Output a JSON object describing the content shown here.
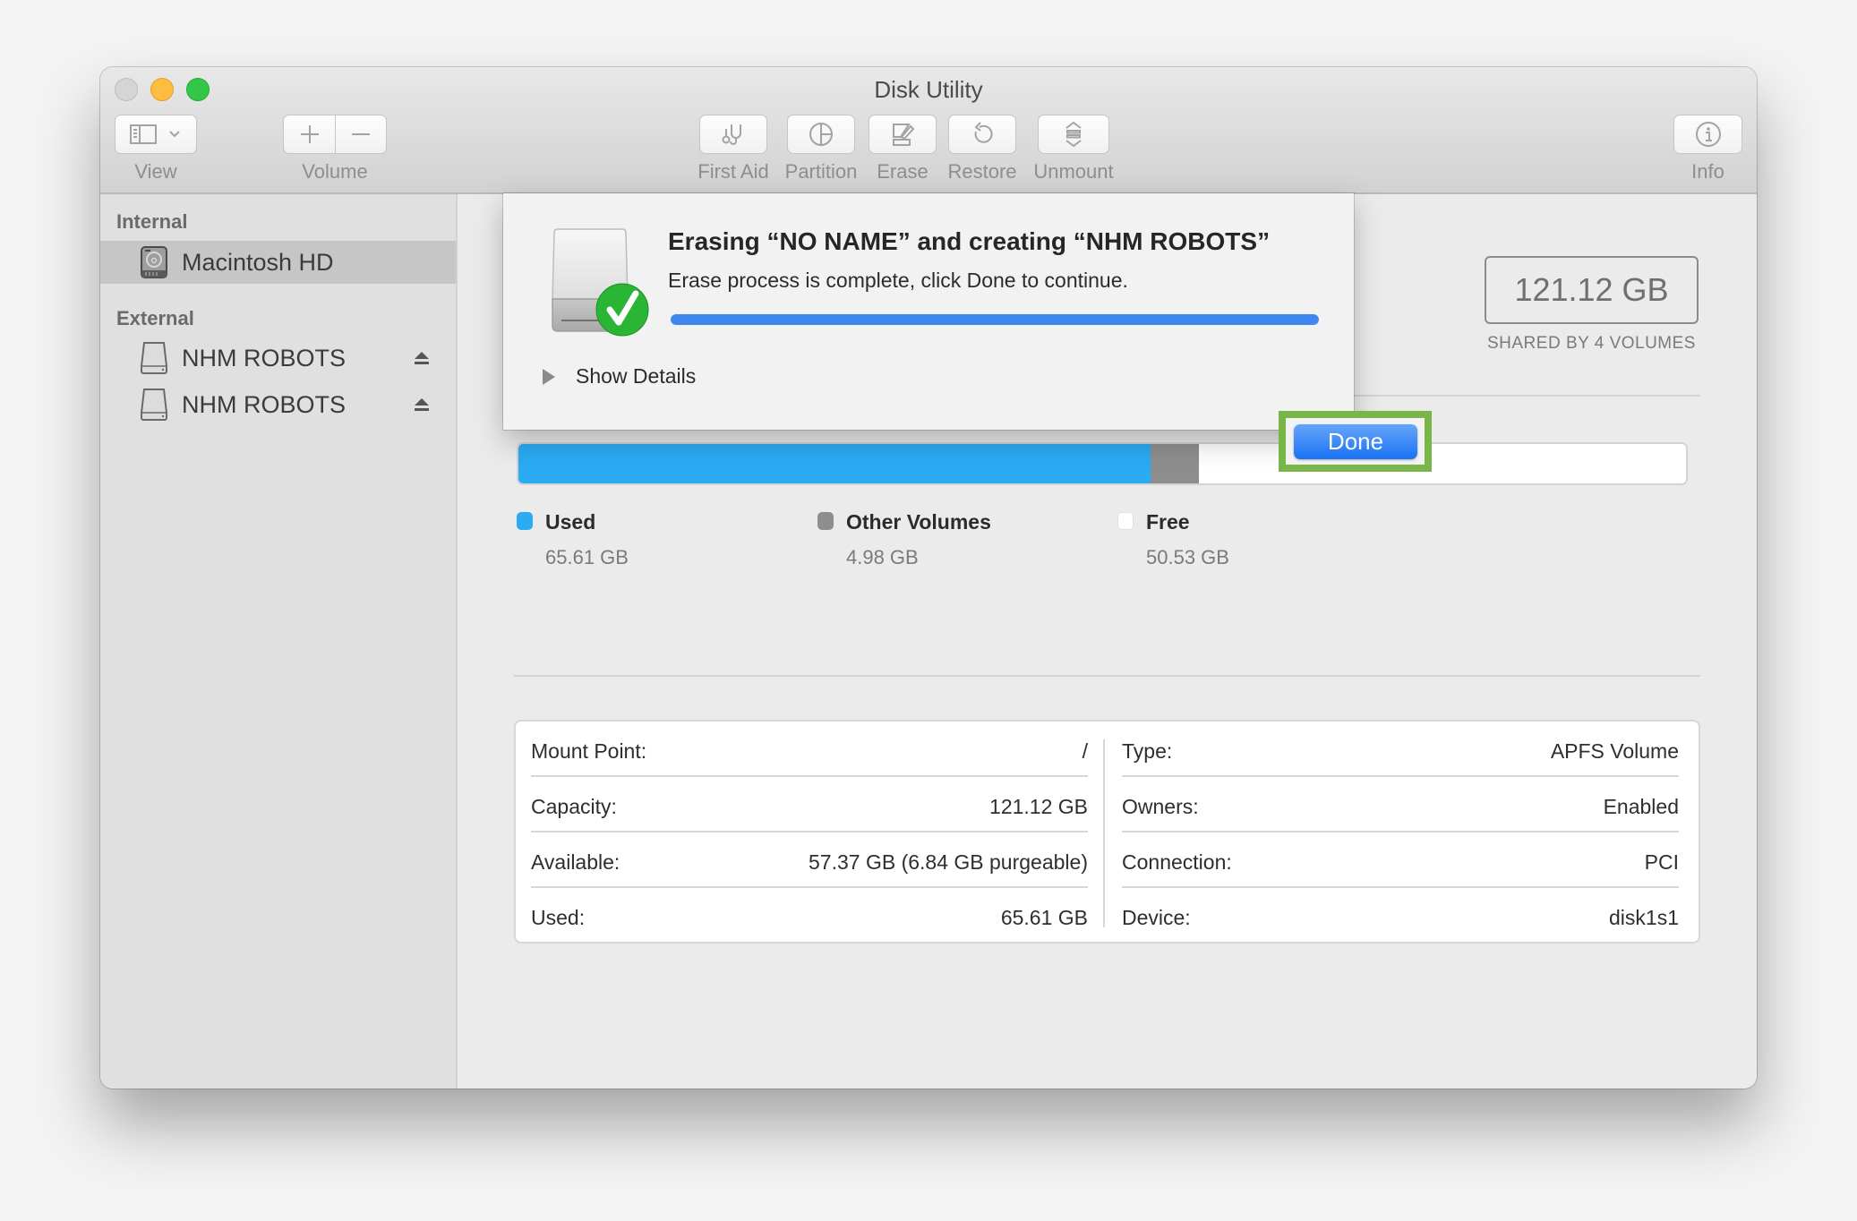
{
  "window": {
    "title": "Disk Utility"
  },
  "toolbar": {
    "view_label": "View",
    "volume_label": "Volume",
    "first_aid_label": "First Aid",
    "partition_label": "Partition",
    "erase_label": "Erase",
    "restore_label": "Restore",
    "unmount_label": "Unmount",
    "info_label": "Info"
  },
  "sidebar": {
    "sections": [
      {
        "title": "Internal",
        "items": [
          {
            "label": "Macintosh HD",
            "icon": "internal-disk-icon",
            "selected": true
          }
        ]
      },
      {
        "title": "External",
        "items": [
          {
            "label": "NHM ROBOTS",
            "icon": "external-disk-icon",
            "eject": true
          },
          {
            "label": "NHM ROBOTS",
            "icon": "external-disk-icon",
            "eject": true
          }
        ]
      }
    ]
  },
  "volume": {
    "capacity": "121.12 GB",
    "shared_by": "SHARED BY 4 VOLUMES",
    "usage": {
      "total_gb": 121.12,
      "segments": [
        {
          "name": "Used",
          "value": "65.61 GB",
          "gb": 65.61,
          "color": "#2aabf3"
        },
        {
          "name": "Other Volumes",
          "value": "4.98 GB",
          "gb": 4.98,
          "color": "#8e8e8e"
        },
        {
          "name": "Free",
          "value": "50.53 GB",
          "gb": 50.53,
          "color": "#ffffff"
        }
      ]
    },
    "info_left": [
      {
        "key": "Mount Point:",
        "value": "/"
      },
      {
        "key": "Capacity:",
        "value": "121.12 GB"
      },
      {
        "key": "Available:",
        "value": "57.37 GB (6.84 GB purgeable)"
      },
      {
        "key": "Used:",
        "value": "65.61 GB"
      }
    ],
    "info_right": [
      {
        "key": "Type:",
        "value": "APFS Volume"
      },
      {
        "key": "Owners:",
        "value": "Enabled"
      },
      {
        "key": "Connection:",
        "value": "PCI"
      },
      {
        "key": "Device:",
        "value": "disk1s1"
      }
    ]
  },
  "dialog": {
    "title": "Erasing “NO NAME” and creating “NHM ROBOTS”",
    "message": "Erase process is complete, click Done to continue.",
    "progress_percent": 100,
    "show_details_label": "Show Details",
    "done_label": "Done",
    "highlight_color": "#7ab547"
  }
}
